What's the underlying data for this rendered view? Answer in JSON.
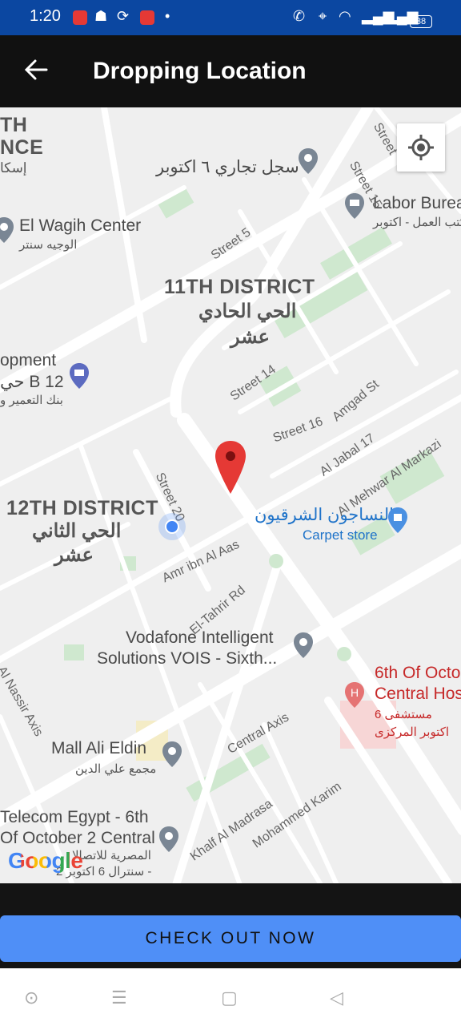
{
  "status_bar": {
    "time": "1:20",
    "battery": "38"
  },
  "header": {
    "title": "Dropping Location",
    "back_icon": "arrow-left-icon"
  },
  "map": {
    "labels": {
      "district_11_en": "11TH DISTRICT",
      "district_11_ar1": "الحي الحادي",
      "district_11_ar2": "عشر",
      "district_12_en": "12TH DISTRICT",
      "district_12_ar1": "الحي الثاني",
      "district_12_ar2": "عشر",
      "top_left_1": "TH",
      "top_left_2": "NCE",
      "top_left_ar": "إسكا",
      "commercial_reg_ar": "سجل تجاري ٦ اكتوبر",
      "labor_en": "Labor Burea",
      "labor_ar": "مكتب العمل - اكتوبر",
      "el_wagih_en": "El Wagih Center",
      "el_wagih_ar": "الوجيه سنتر",
      "development_en": "opment",
      "development_en2": "حي B 12",
      "development_ar": "بنك التعمير و",
      "carpet_ar": "النساجون الشرقيون",
      "carpet_en": "Carpet store",
      "vodafone_1": "Vodafone Intelligent",
      "vodafone_2": "Solutions VOIS - Sixth...",
      "hospital_1": "6th Of Octo",
      "hospital_2": "Central Hos",
      "hospital_ar1": "مستشفى 6",
      "hospital_ar2": "اكتوبر المركزى",
      "mall_en": "Mall Ali Eldin",
      "mall_ar": "مجمع علي الدين",
      "telecom_1": "Telecom Egypt - 6th",
      "telecom_2": "Of October 2 Central",
      "telecom_ar1": "المصرية للاتصالا",
      "telecom_ar2": "سنترال 6 اكتوبر 2 -"
    },
    "streets": {
      "street15": "Street 15",
      "street5": "Street 5",
      "street14": "Street 14",
      "street16": "Street 16",
      "amgad": "Amgad St",
      "aljabal": "Al Jabal 17",
      "mehwar": "Al Mehwar Al Markazi",
      "street20": "Street 20",
      "amr": "Amr ibn Al Aas",
      "eltahrir": "El-Tahrir Rd",
      "central": "Central Axis",
      "nassir": "Al Nassir Axis",
      "khalf": "Khalf Al Madrasa",
      "mohammed": "Mohammed Karim",
      "street_top": "Street"
    },
    "logo": "Google"
  },
  "action": {
    "checkout_label": "CHECK OUT NOW"
  },
  "colors": {
    "status_bar": "#0b47a1",
    "app_bar": "#111111",
    "button": "#4f8ff7",
    "marker": "#e53935"
  }
}
